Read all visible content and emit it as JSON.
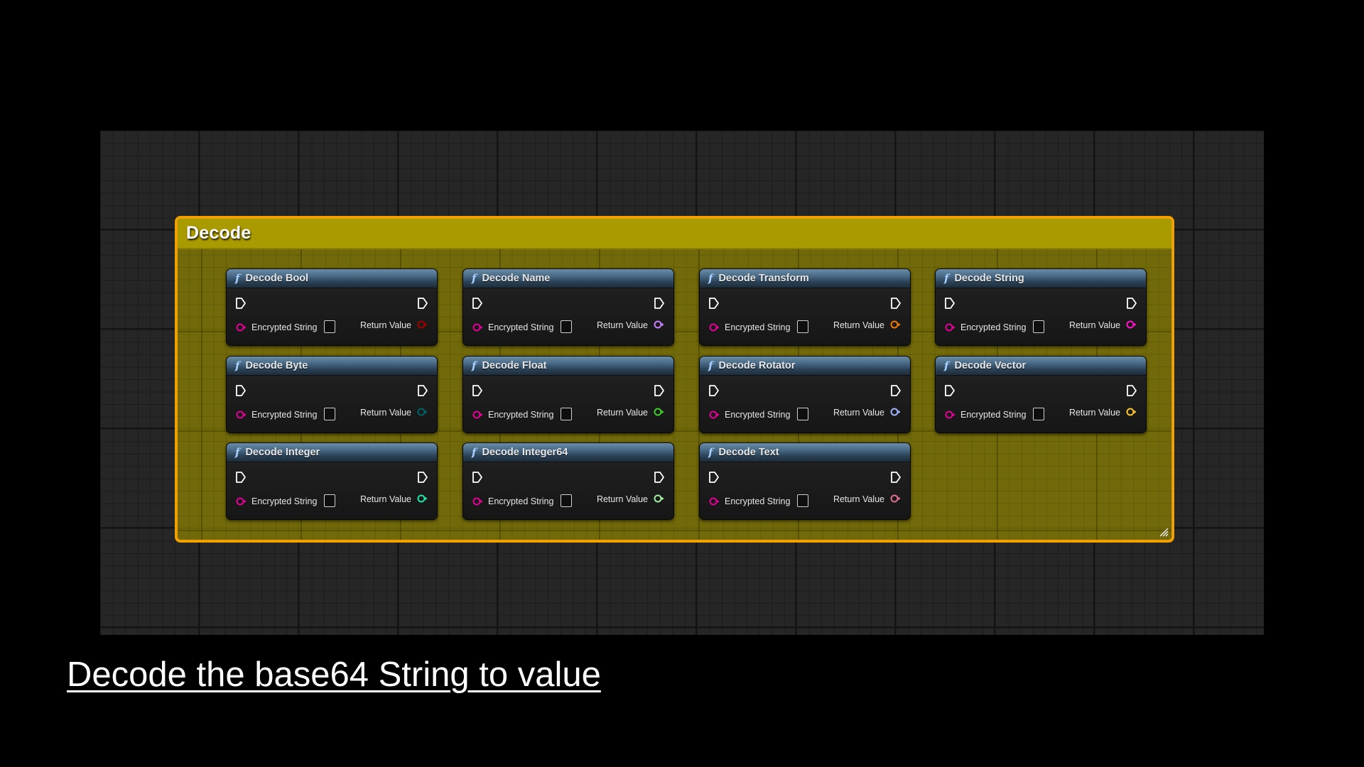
{
  "comment": {
    "title": "Decode",
    "border_color": "#f0a000",
    "header_color": "#a99a00"
  },
  "common": {
    "input_label": "Encrypted String",
    "output_label": "Return Value",
    "func_icon": "function-icon",
    "input_pin_color": "#e60096"
  },
  "nodes": [
    {
      "title": "Decode Bool",
      "return_pin_color": "#a00000"
    },
    {
      "title": "Decode Name",
      "return_pin_color": "#c880ff"
    },
    {
      "title": "Decode Transform",
      "return_pin_color": "#f07800"
    },
    {
      "title": "Decode String",
      "return_pin_color": "#ff14c8"
    },
    {
      "title": "Decode Byte",
      "return_pin_color": "#006464"
    },
    {
      "title": "Decode Float",
      "return_pin_color": "#3cd228"
    },
    {
      "title": "Decode Rotator",
      "return_pin_color": "#a0b4ff"
    },
    {
      "title": "Decode Vector",
      "return_pin_color": "#ffc828"
    },
    {
      "title": "Decode Integer",
      "return_pin_color": "#1ee6aa"
    },
    {
      "title": "Decode Integer64",
      "return_pin_color": "#a0f0a0"
    },
    {
      "title": "Decode Text",
      "return_pin_color": "#e07090"
    }
  ],
  "caption": "Decode the base64 String to value"
}
